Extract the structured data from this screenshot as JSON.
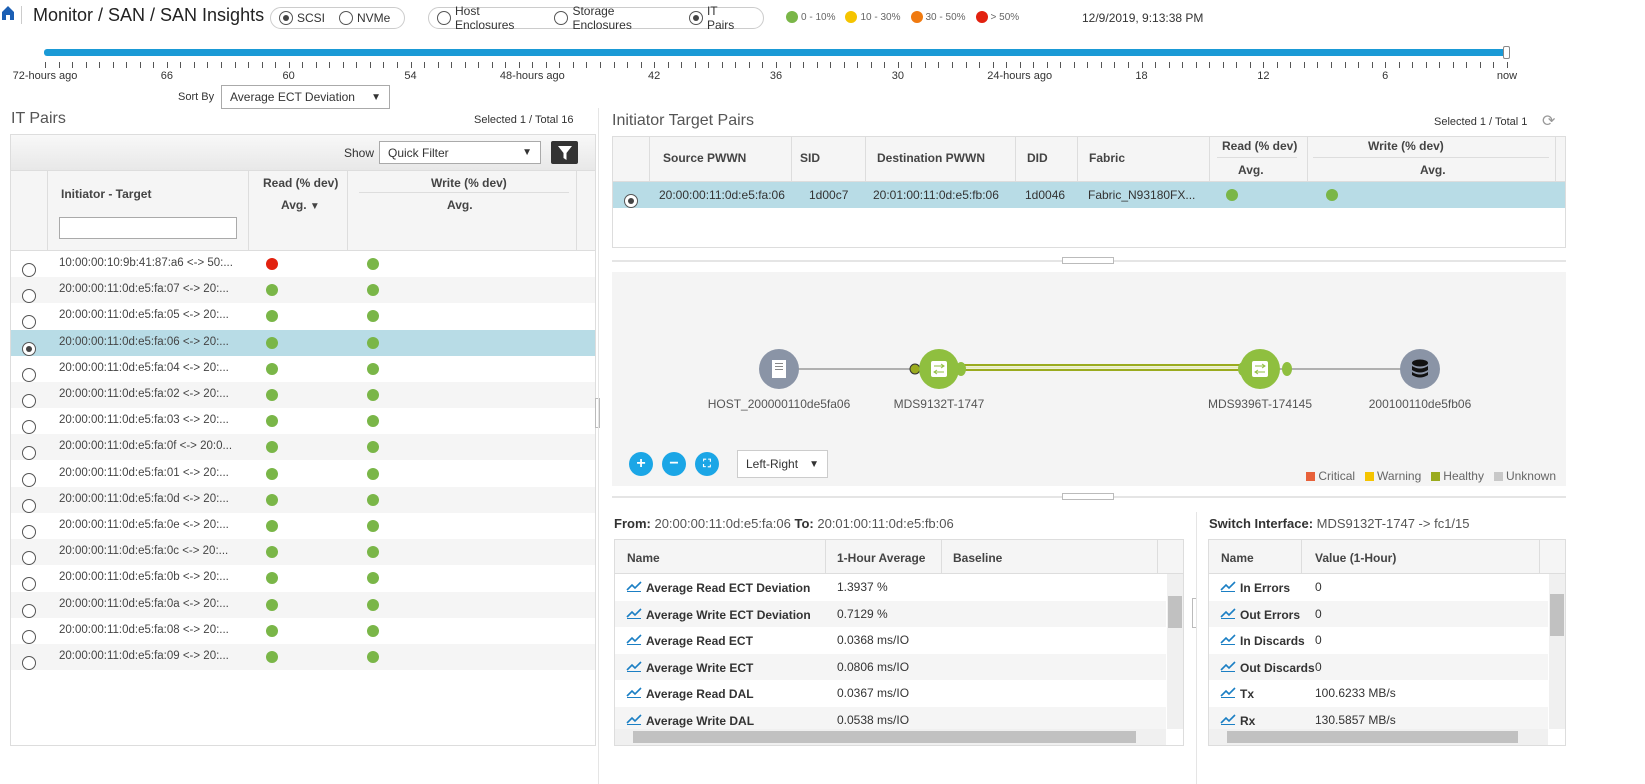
{
  "header": {
    "title": "Monitor / SAN / SAN Insights",
    "protocols": [
      {
        "label": "SCSI",
        "selected": true
      },
      {
        "label": "NVMe",
        "selected": false
      }
    ],
    "views": [
      {
        "label": "Host Enclosures",
        "selected": false
      },
      {
        "label": "Storage Enclosures",
        "selected": false
      },
      {
        "label": "IT Pairs",
        "selected": true
      }
    ],
    "legend": [
      {
        "label": "0 - 10%",
        "color": "#7ab648"
      },
      {
        "label": "10 - 30%",
        "color": "#f5c400"
      },
      {
        "label": "30 - 50%",
        "color": "#f07a10"
      },
      {
        "label": "> 50%",
        "color": "#e2210f"
      }
    ],
    "timestamp": "12/9/2019, 9:13:38 PM"
  },
  "timeline": {
    "labels": [
      "72-hours ago",
      "66",
      "60",
      "54",
      "48-hours ago",
      "42",
      "36",
      "30",
      "24-hours ago",
      "18",
      "12",
      "6",
      "now"
    ],
    "selected_range_percent": [
      0,
      100
    ]
  },
  "sort": {
    "label": "Sort By",
    "value": "Average ECT Deviation"
  },
  "left": {
    "title": "IT Pairs",
    "count": "Selected 1 / Total 16",
    "show_label": "Show",
    "filter_value": "Quick Filter",
    "columns": {
      "it": "Initiator - Target",
      "read": "Read (% dev)",
      "read_sub": "Avg.",
      "write": "Write (% dev)",
      "write_sub": "Avg."
    },
    "rows": [
      {
        "name": "10:00:00:10:9b:41:87:a6 <-> 50:...",
        "read": "#e2210f",
        "write": "#7ab648",
        "selected": false
      },
      {
        "name": "20:00:00:11:0d:e5:fa:07 <-> 20:...",
        "read": "#7ab648",
        "write": "#7ab648",
        "selected": false
      },
      {
        "name": "20:00:00:11:0d:e5:fa:05 <-> 20:...",
        "read": "#7ab648",
        "write": "#7ab648",
        "selected": false
      },
      {
        "name": "20:00:00:11:0d:e5:fa:06 <-> 20:...",
        "read": "#7ab648",
        "write": "#7ab648",
        "selected": true
      },
      {
        "name": "20:00:00:11:0d:e5:fa:04 <-> 20:...",
        "read": "#7ab648",
        "write": "#7ab648",
        "selected": false
      },
      {
        "name": "20:00:00:11:0d:e5:fa:02 <-> 20:...",
        "read": "#7ab648",
        "write": "#7ab648",
        "selected": false
      },
      {
        "name": "20:00:00:11:0d:e5:fa:03 <-> 20:...",
        "read": "#7ab648",
        "write": "#7ab648",
        "selected": false
      },
      {
        "name": "20:00:00:11:0d:e5:fa:0f <-> 20:0...",
        "read": "#7ab648",
        "write": "#7ab648",
        "selected": false
      },
      {
        "name": "20:00:00:11:0d:e5:fa:01 <-> 20:...",
        "read": "#7ab648",
        "write": "#7ab648",
        "selected": false
      },
      {
        "name": "20:00:00:11:0d:e5:fa:0d <-> 20:...",
        "read": "#7ab648",
        "write": "#7ab648",
        "selected": false
      },
      {
        "name": "20:00:00:11:0d:e5:fa:0e <-> 20:...",
        "read": "#7ab648",
        "write": "#7ab648",
        "selected": false
      },
      {
        "name": "20:00:00:11:0d:e5:fa:0c <-> 20:...",
        "read": "#7ab648",
        "write": "#7ab648",
        "selected": false
      },
      {
        "name": "20:00:00:11:0d:e5:fa:0b <-> 20:...",
        "read": "#7ab648",
        "write": "#7ab648",
        "selected": false
      },
      {
        "name": "20:00:00:11:0d:e5:fa:0a <-> 20:...",
        "read": "#7ab648",
        "write": "#7ab648",
        "selected": false
      },
      {
        "name": "20:00:00:11:0d:e5:fa:08 <-> 20:...",
        "read": "#7ab648",
        "write": "#7ab648",
        "selected": false
      },
      {
        "name": "20:00:00:11:0d:e5:fa:09 <-> 20:...",
        "read": "#7ab648",
        "write": "#7ab648",
        "selected": false
      }
    ]
  },
  "right": {
    "title": "Initiator Target Pairs",
    "count": "Selected 1 / Total 1",
    "columns": {
      "src": "Source PWWN",
      "sid": "SID",
      "dst": "Destination PWWN",
      "did": "DID",
      "fabric": "Fabric",
      "read": "Read (% dev)",
      "read_sub": "Avg.",
      "write": "Write (% dev)",
      "write_sub": "Avg."
    },
    "row": {
      "src": "20:00:00:11:0d:e5:fa:06",
      "sid": "1d00c7",
      "dst": "20:01:00:11:0d:e5:fb:06",
      "did": "1d0046",
      "fabric": "Fabric_N93180FX...",
      "read": "#7ab648",
      "write": "#7ab648"
    }
  },
  "topology": {
    "nodes": [
      "HOST_200000110de5fa06",
      "MDS9132T-1747",
      "MDS9396T-174145",
      "200100110de5fb06"
    ],
    "layout": "Left-Right",
    "legend": [
      {
        "label": "Critical",
        "color": "#e8613a"
      },
      {
        "label": "Warning",
        "color": "#f5c400"
      },
      {
        "label": "Healthy",
        "color": "#9aab1e"
      },
      {
        "label": "Unknown",
        "color": "#c8c8c8"
      }
    ]
  },
  "metrics": {
    "from_label": "From:",
    "from": "20:00:00:11:0d:e5:fa:06",
    "to_label": "To:",
    "to": "20:01:00:11:0d:e5:fb:06",
    "columns": [
      "Name",
      "1-Hour Average",
      "Baseline"
    ],
    "rows": [
      {
        "name": "Average Read ECT Deviation",
        "value": "1.3937 %"
      },
      {
        "name": "Average Write ECT Deviation",
        "value": "0.7129 %"
      },
      {
        "name": "Average Read ECT",
        "value": "0.0368 ms/IO"
      },
      {
        "name": "Average Write ECT",
        "value": "0.0806 ms/IO"
      },
      {
        "name": "Average Read DAL",
        "value": "0.0367 ms/IO"
      },
      {
        "name": "Average Write DAL",
        "value": "0.0538 ms/IO"
      }
    ]
  },
  "switch": {
    "label": "Switch Interface:",
    "value": "MDS9132T-1747 -> fc1/15",
    "columns": [
      "Name",
      "Value (1-Hour)"
    ],
    "rows": [
      {
        "name": "In Errors",
        "value": "0"
      },
      {
        "name": "Out Errors",
        "value": "0"
      },
      {
        "name": "In Discards",
        "value": "0"
      },
      {
        "name": "Out Discards",
        "value": "0"
      },
      {
        "name": "Tx",
        "value": "100.6233 MB/s"
      },
      {
        "name": "Rx",
        "value": "130.5857 MB/s"
      }
    ]
  }
}
